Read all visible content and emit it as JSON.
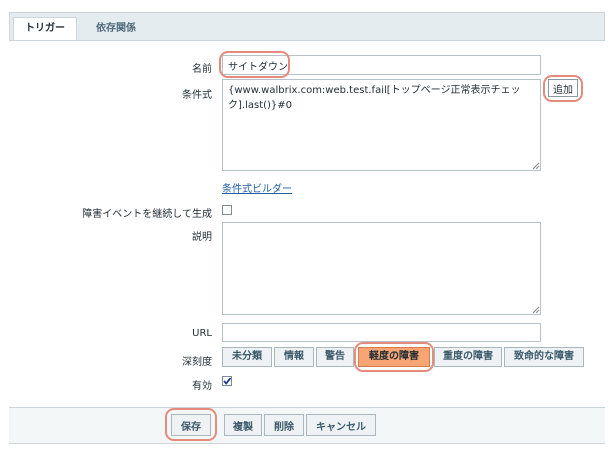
{
  "tabs": [
    {
      "label": "トリガー"
    },
    {
      "label": "依存関係"
    }
  ],
  "form": {
    "name": {
      "label": "名前",
      "value": "サイトダウン"
    },
    "expression": {
      "label": "条件式",
      "value": "{www.walbrix.com:web.test.fail[トップページ正常表示チェック].last()}#0",
      "add_label": "追加",
      "builder_link": "条件式ビルダー"
    },
    "multiple_events": {
      "label": "障害イベントを継続して生成",
      "checked": false
    },
    "description": {
      "label": "説明",
      "value": ""
    },
    "url": {
      "label": "URL",
      "value": ""
    },
    "severity": {
      "label": "深刻度",
      "options": [
        "未分類",
        "情報",
        "警告",
        "軽度の障害",
        "重度の障害",
        "致命的な障害"
      ],
      "selected": "軽度の障害"
    },
    "enabled": {
      "label": "有効",
      "checked": true
    }
  },
  "footer": {
    "save": "保存",
    "clone": "複製",
    "delete": "削除",
    "cancel": "キャンセル"
  },
  "colors": {
    "highlight": "#e58b7b",
    "selected_severity": "#f7a574",
    "link": "#1f5fa8"
  }
}
